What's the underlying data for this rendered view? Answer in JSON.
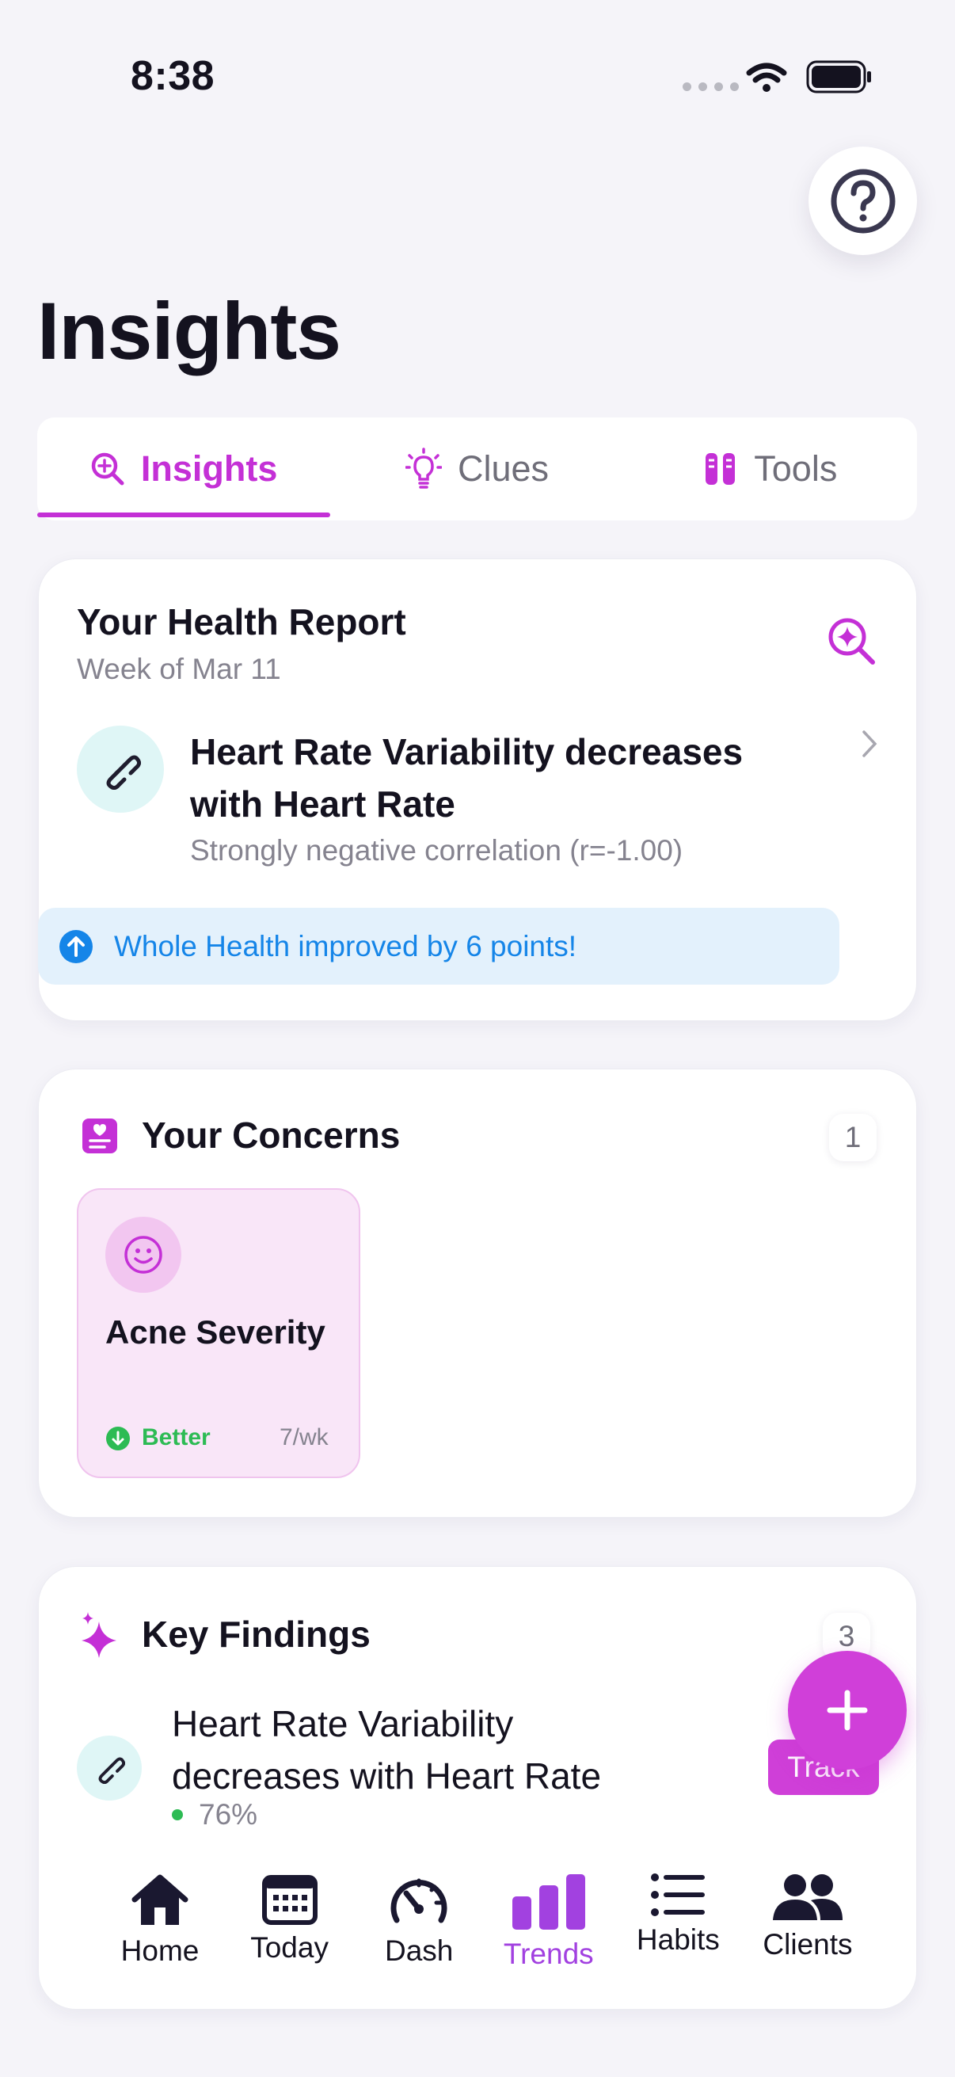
{
  "status_bar": {
    "time": "8:38"
  },
  "page_title": "Insights",
  "tabs": [
    {
      "label": "Insights",
      "icon": "search-sparkle-icon",
      "active": true
    },
    {
      "label": "Clues",
      "icon": "lightbulb-icon",
      "active": false
    },
    {
      "label": "Tools",
      "icon": "test-tubes-icon",
      "active": false
    }
  ],
  "health_report": {
    "title": "Your Health Report",
    "subtitle": "Week of Mar 11",
    "insight_title": "Heart Rate Variability decreases with Heart Rate",
    "insight_detail": "Strongly negative correlation (r=-1.00)",
    "banner_text": "Whole Health improved by 6 points!"
  },
  "concerns": {
    "title": "Your Concerns",
    "count": "1",
    "items": [
      {
        "name": "Acne Severity",
        "status": "Better",
        "frequency": "7/wk"
      }
    ]
  },
  "key_findings": {
    "title": "Key Findings",
    "count": "3",
    "items": [
      {
        "title": "Heart Rate Variability decreases with Heart Rate",
        "confidence": "76%",
        "action": "Track"
      }
    ]
  },
  "bottom_nav": [
    {
      "label": "Home",
      "icon": "home-icon",
      "active": false
    },
    {
      "label": "Today",
      "icon": "calendar-icon",
      "active": false
    },
    {
      "label": "Dash",
      "icon": "speedometer-icon",
      "active": false
    },
    {
      "label": "Trends",
      "icon": "bar-chart-icon",
      "active": true
    },
    {
      "label": "Habits",
      "icon": "list-icon",
      "active": false
    },
    {
      "label": "Clients",
      "icon": "people-icon",
      "active": false
    }
  ],
  "colors": {
    "accent": "#c430d6",
    "nav_active": "#a241e0",
    "banner_text": "#1585e8",
    "better": "#2dbb54"
  }
}
